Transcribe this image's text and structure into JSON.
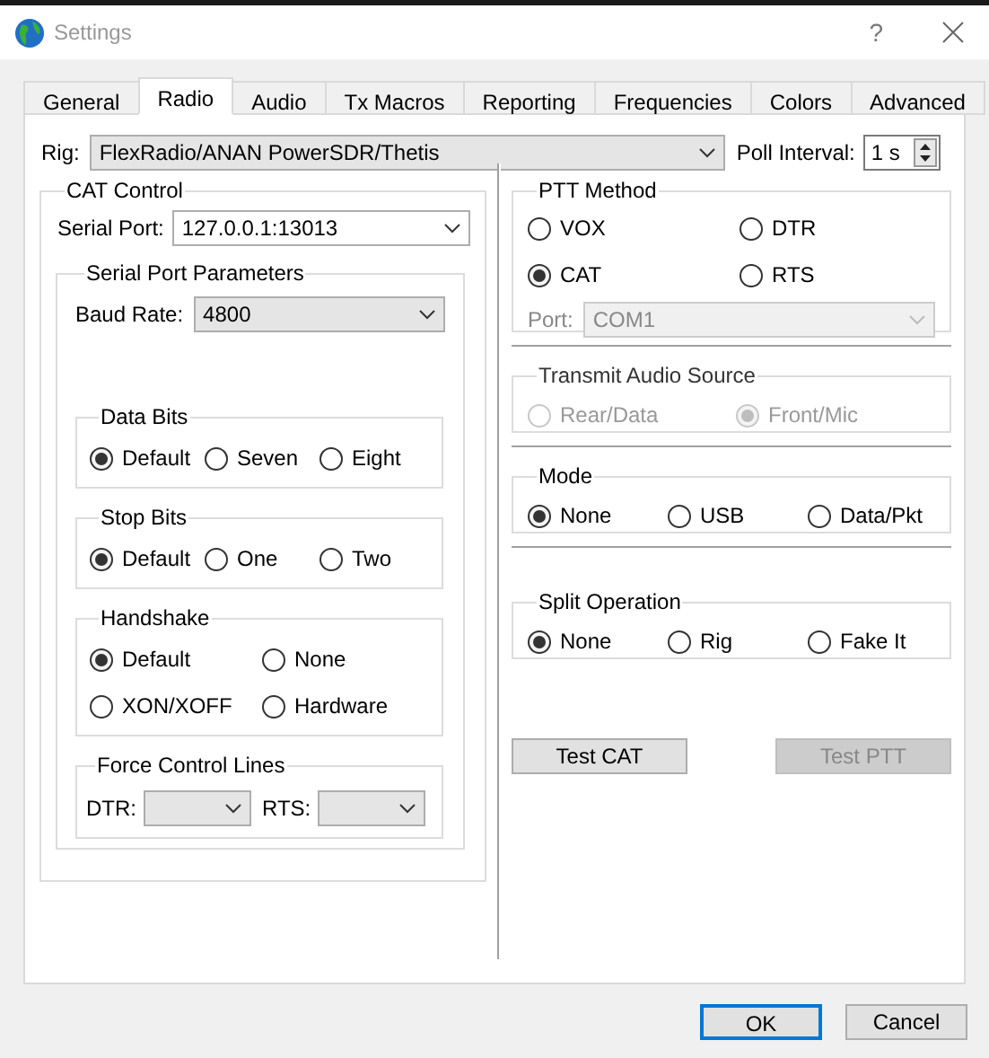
{
  "window": {
    "title": "Settings",
    "help": "?"
  },
  "tabs": [
    {
      "label": "General",
      "selected": false
    },
    {
      "label": "Radio",
      "selected": true
    },
    {
      "label": "Audio",
      "selected": false
    },
    {
      "label": "Tx Macros",
      "selected": false
    },
    {
      "label": "Reporting",
      "selected": false
    },
    {
      "label": "Frequencies",
      "selected": false
    },
    {
      "label": "Colors",
      "selected": false
    },
    {
      "label": "Advanced",
      "selected": false
    }
  ],
  "rig": {
    "label": "Rig:",
    "value": "FlexRadio/ANAN PowerSDR/Thetis"
  },
  "poll_interval": {
    "label": "Poll Interval:",
    "value": "1 s"
  },
  "cat_control": {
    "title": "CAT Control",
    "serial_port": {
      "label": "Serial Port:",
      "value": "127.0.0.1:13013"
    },
    "serial_port_parameters": {
      "title": "Serial Port Parameters",
      "baud_rate": {
        "label": "Baud Rate:",
        "value": "4800"
      },
      "groups": [
        {
          "title": "Data Bits",
          "options": [
            {
              "label": "Default",
              "selected": true
            },
            {
              "label": "Seven",
              "selected": false
            },
            {
              "label": "Eight",
              "selected": false
            }
          ]
        },
        {
          "title": "Stop Bits",
          "options": [
            {
              "label": "Default",
              "selected": true
            },
            {
              "label": "One",
              "selected": false
            },
            {
              "label": "Two",
              "selected": false
            }
          ]
        },
        {
          "title": "Handshake",
          "options": [
            {
              "label": "Default",
              "selected": true
            },
            {
              "label": "None",
              "selected": false
            },
            {
              "label": "XON/XOFF",
              "selected": false
            },
            {
              "label": "Hardware",
              "selected": false
            }
          ]
        }
      ],
      "force_control_lines": {
        "title": "Force Control Lines",
        "fields": [
          {
            "label": "DTR:"
          },
          {
            "label": "RTS:"
          }
        ]
      }
    }
  },
  "ptt_method": {
    "title": "PTT Method",
    "options": [
      {
        "label": "VOX",
        "selected": false
      },
      {
        "label": "DTR",
        "selected": false
      },
      {
        "label": "CAT",
        "selected": true
      },
      {
        "label": "RTS",
        "selected": false
      }
    ],
    "port": {
      "label": "Port:",
      "value": "COM1",
      "disabled": true
    }
  },
  "right_groups": [
    {
      "title": "Transmit Audio Source",
      "disabled": true,
      "options": [
        {
          "label": "Rear/Data",
          "selected": false
        },
        {
          "label": "Front/Mic",
          "selected": true
        }
      ]
    },
    {
      "title": "Mode",
      "disabled": false,
      "options": [
        {
          "label": "None",
          "selected": true
        },
        {
          "label": "USB",
          "selected": false
        },
        {
          "label": "Data/Pkt",
          "selected": false
        }
      ]
    },
    {
      "title": "Split Operation",
      "disabled": false,
      "options": [
        {
          "label": "None",
          "selected": true
        },
        {
          "label": "Rig",
          "selected": false
        },
        {
          "label": "Fake It",
          "selected": false
        }
      ]
    }
  ],
  "test_buttons": [
    {
      "label": "Test CAT",
      "disabled": false
    },
    {
      "label": "Test PTT",
      "disabled": true
    }
  ],
  "dialog_buttons": [
    {
      "label": "OK",
      "default": true
    },
    {
      "label": "Cancel",
      "default": false
    }
  ]
}
